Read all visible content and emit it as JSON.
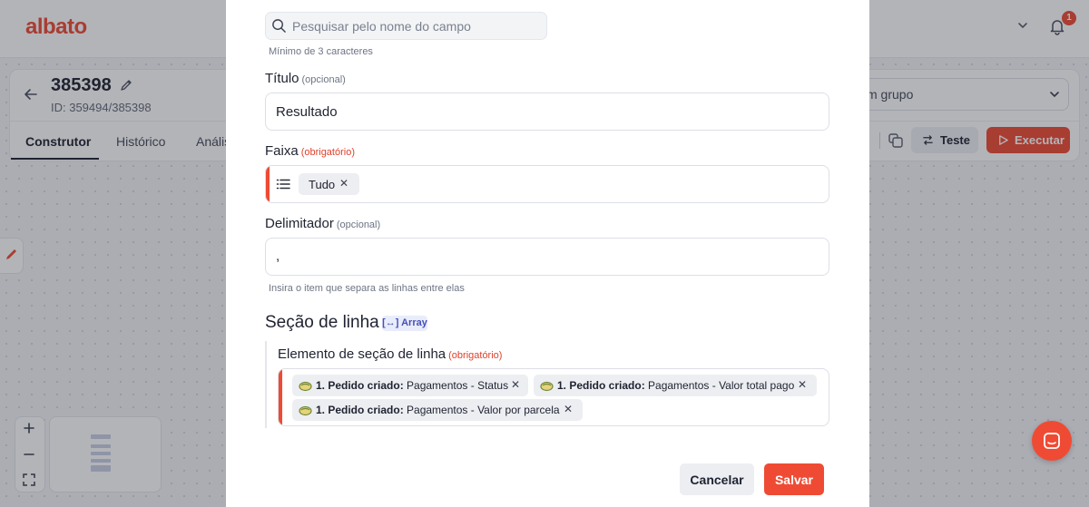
{
  "brand": {
    "logo_text": "albato",
    "accent_color": "#ef4b34"
  },
  "topbar": {
    "notification_count": "1",
    "icons": [
      "chevron-down-icon",
      "bell-icon"
    ]
  },
  "bot": {
    "title": "385398",
    "id_text": "ID: 359494/385398"
  },
  "tabs": [
    {
      "label": "Construtor",
      "active": true
    },
    {
      "label": "Histórico",
      "active": false
    },
    {
      "label": "Anális",
      "active": false
    }
  ],
  "group_select": {
    "value": "m grupo"
  },
  "actions": {
    "test_label": "Teste",
    "execute_label": "Executar"
  },
  "modal": {
    "search": {
      "placeholder": "Pesquisar pelo nome do campo",
      "value": "",
      "hint": "Mínimo de 3 caracteres"
    },
    "title_field": {
      "label": "Título",
      "tag": "(opcional)",
      "value": "Resultado"
    },
    "range_field": {
      "label": "Faixa",
      "tag": "(obrigatório)",
      "chip": "Tudo"
    },
    "delimiter_field": {
      "label": "Delimitador",
      "tag": "(opcional)",
      "value": ",",
      "hint": "Insira o item que separa as linhas entre elas"
    },
    "section": {
      "title": "Seção de linha",
      "badge": "[↔] Array",
      "element_label": "Elemento de seção de linha",
      "element_tag": "(obrigatório)",
      "chips": [
        {
          "source": "1. Pedido criado:",
          "field": "Pagamentos - Status"
        },
        {
          "source": "1. Pedido criado:",
          "field": "Pagamentos - Valor total pago"
        },
        {
          "source": "1. Pedido criado:",
          "field": "Pagamentos - Valor por parcela"
        }
      ]
    },
    "buttons": {
      "cancel": "Cancelar",
      "save": "Salvar"
    }
  }
}
